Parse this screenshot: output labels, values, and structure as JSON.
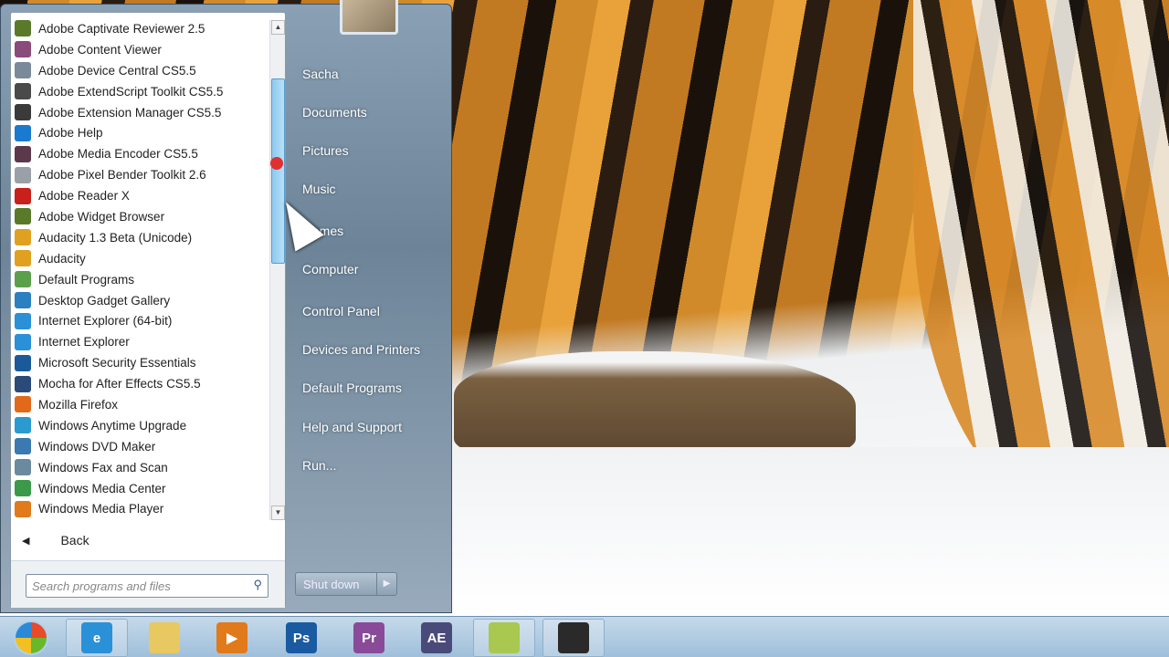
{
  "programs": [
    {
      "label": "Adobe Captivate Reviewer 2.5",
      "color": "#5a7a2a"
    },
    {
      "label": "Adobe Content Viewer",
      "color": "#8a4a7a"
    },
    {
      "label": "Adobe Device Central CS5.5",
      "color": "#7a8a9a"
    },
    {
      "label": "Adobe ExtendScript Toolkit CS5.5",
      "color": "#4a4a4a"
    },
    {
      "label": "Adobe Extension Manager CS5.5",
      "color": "#3a3a3a"
    },
    {
      "label": "Adobe Help",
      "color": "#1a7ad0"
    },
    {
      "label": "Adobe Media Encoder CS5.5",
      "color": "#5a3a4a"
    },
    {
      "label": "Adobe Pixel Bender Toolkit 2.6",
      "color": "#9aa0a8"
    },
    {
      "label": "Adobe Reader X",
      "color": "#c8201a"
    },
    {
      "label": "Adobe Widget Browser",
      "color": "#5a7a2a"
    },
    {
      "label": "Audacity 1.3 Beta (Unicode)",
      "color": "#e0a020"
    },
    {
      "label": "Audacity",
      "color": "#e0a020"
    },
    {
      "label": "Default Programs",
      "color": "#5aa04a"
    },
    {
      "label": "Desktop Gadget Gallery",
      "color": "#2a80c0"
    },
    {
      "label": "Internet Explorer (64-bit)",
      "color": "#2a90d8"
    },
    {
      "label": "Internet Explorer",
      "color": "#2a90d8"
    },
    {
      "label": "Microsoft Security Essentials",
      "color": "#1a5a9a"
    },
    {
      "label": "Mocha for After Effects CS5.5",
      "color": "#2a4a7a"
    },
    {
      "label": "Mozilla Firefox",
      "color": "#e06a1a"
    },
    {
      "label": "Windows Anytime Upgrade",
      "color": "#2a9ad0"
    },
    {
      "label": "Windows DVD Maker",
      "color": "#3a7ab0"
    },
    {
      "label": "Windows Fax and Scan",
      "color": "#6a8aa0"
    },
    {
      "label": "Windows Media Center",
      "color": "#3a9a4a"
    },
    {
      "label": "Windows Media Player",
      "color": "#e07a1a"
    }
  ],
  "back_label": "Back",
  "search_placeholder": "Search programs and files",
  "right_links": [
    "Sacha",
    "Documents",
    "Pictures",
    "Music",
    "Games",
    "Computer",
    "Control Panel",
    "Devices and Printers",
    "Default Programs",
    "Help and Support",
    "Run..."
  ],
  "shutdown_label": "Shut down",
  "taskbar": [
    {
      "name": "internet-explorer",
      "label": "e",
      "color": "#2a90d8"
    },
    {
      "name": "windows-explorer",
      "label": "",
      "color": "#e8c860"
    },
    {
      "name": "media-player",
      "label": "▶",
      "color": "#e07a1a"
    },
    {
      "name": "photoshop",
      "label": "Ps",
      "color": "#1a5aa0"
    },
    {
      "name": "premiere",
      "label": "Pr",
      "color": "#8a4a9a"
    },
    {
      "name": "after-effects",
      "label": "AE",
      "color": "#4a4a7a"
    },
    {
      "name": "app-green",
      "label": "",
      "color": "#a8c850"
    },
    {
      "name": "camera-app",
      "label": "",
      "color": "#2a2a2a"
    }
  ]
}
